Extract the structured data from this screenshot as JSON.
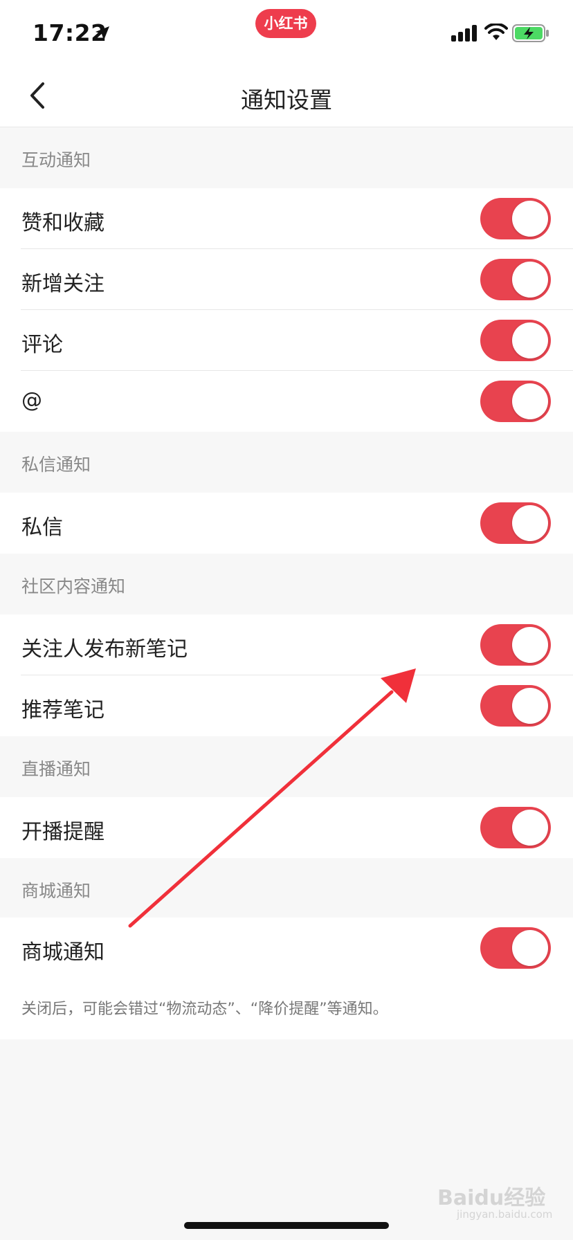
{
  "status_bar": {
    "time": "17:22",
    "brand_badge": "小红书",
    "icons": [
      "location-arrow-icon",
      "signal-bars-icon",
      "wifi-icon",
      "battery-charging-icon"
    ]
  },
  "nav": {
    "title": "通知设置",
    "back_icon": "chevron-left-icon"
  },
  "sections": [
    {
      "header": "互动通知",
      "items": [
        {
          "label": "赞和收藏",
          "enabled": true
        },
        {
          "label": "新增关注",
          "enabled": true
        },
        {
          "label": "评论",
          "enabled": true
        },
        {
          "label": "@",
          "enabled": true
        }
      ]
    },
    {
      "header": "私信通知",
      "items": [
        {
          "label": "私信",
          "enabled": true
        }
      ]
    },
    {
      "header": "社区内容通知",
      "items": [
        {
          "label": "关注人发布新笔记",
          "enabled": true
        },
        {
          "label": "推荐笔记",
          "enabled": true
        }
      ]
    },
    {
      "header": "直播通知",
      "items": [
        {
          "label": "开播提醒",
          "enabled": true
        }
      ]
    },
    {
      "header": "商城通知",
      "items": [
        {
          "label": "商城通知",
          "enabled": true
        }
      ]
    }
  ],
  "footnote": "关闭后，可能会错过“物流动态”、“降价提醒”等通知。",
  "colors": {
    "accent": "#e8434f",
    "brand": "#ee3d4d",
    "annotation": "#f0303a"
  },
  "watermark": {
    "main": "Baidu经验",
    "sub": "jingyan.baidu.com"
  }
}
